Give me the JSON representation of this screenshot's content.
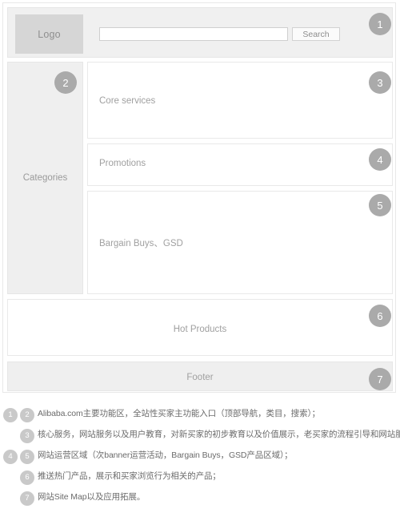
{
  "header": {
    "logo_label": "Logo",
    "search_value": "",
    "search_placeholder": "",
    "search_button_label": "Search"
  },
  "sidebar": {
    "label": "Categories"
  },
  "panels": [
    {
      "id": "core",
      "label": "Core services"
    },
    {
      "id": "promo",
      "label": "Promotions"
    },
    {
      "id": "bargain",
      "label": "Bargain Buys、GSD"
    },
    {
      "id": "hot",
      "label": "Hot Products"
    },
    {
      "id": "footer",
      "label": "Footer"
    }
  ],
  "badges": {
    "b1": "1",
    "b2": "2",
    "b3": "3",
    "b4": "4",
    "b5": "5",
    "b6": "6",
    "b7": "7"
  },
  "legend": [
    {
      "badge_a": "1",
      "badge_b": "2",
      "text": "Alibaba.com主要功能区，全站性买家主功能入口（顶部导航，类目，搜索）；"
    },
    {
      "badge_a": "",
      "badge_b": "3",
      "text": "核心服务，网站服务以及用户教育，对新买家的初步教育以及价值展示，老买家的流程引导和网站服务介绍；"
    },
    {
      "badge_a": "4",
      "badge_b": "5",
      "text": "网站运营区域（次banner运营活动，Bargain Buys，GSD产品区域）；"
    },
    {
      "badge_a": "",
      "badge_b": "6",
      "text": "推送热门产品，展示和买家浏览行为相关的产品；"
    },
    {
      "badge_a": "",
      "badge_b": "7",
      "text": "网站Site Map以及应用拓展。"
    }
  ],
  "colors": {
    "badge_fill": "#aaaaaa",
    "legend_badge_fill": "#c9c9c9",
    "panel_gray": "#efefef",
    "logo_gray": "#d6d6d6"
  }
}
